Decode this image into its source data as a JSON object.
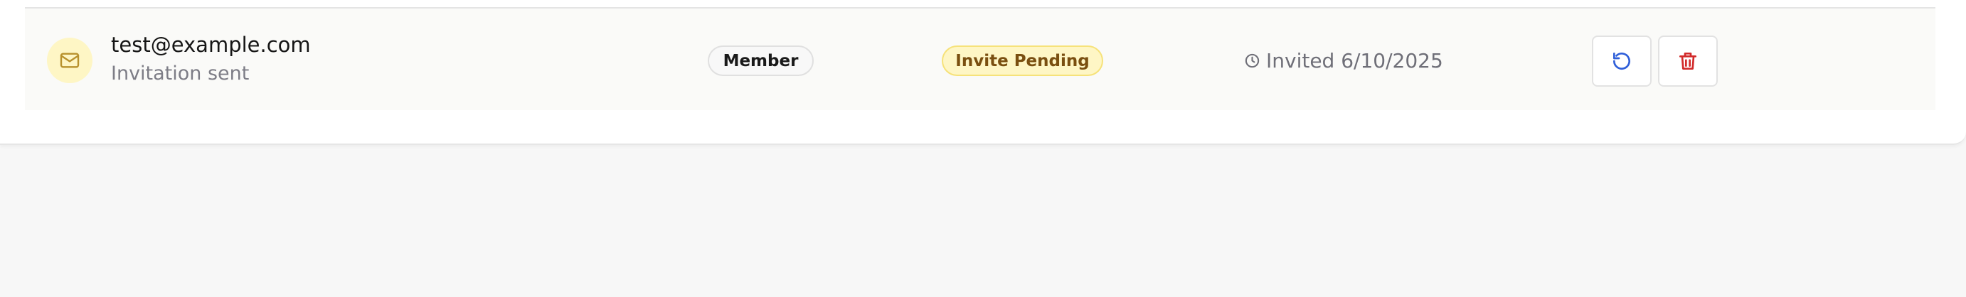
{
  "member_row": {
    "email": "test@example.com",
    "subtitle": "Invitation sent",
    "role": "Member",
    "status": "Invite Pending",
    "invited_text": "Invited 6/10/2025",
    "icons": {
      "avatar": "mail-icon",
      "invited": "clock-icon",
      "resend": "refresh-icon",
      "delete": "trash-icon"
    }
  },
  "colors": {
    "avatar_bg": "#fef6c5",
    "avatar_icon": "#b8912d",
    "status_bg": "#fef6c5",
    "status_border": "#f6e27a",
    "status_text": "#7a4f10",
    "resend_icon": "#2f5fd9",
    "delete_icon": "#d22a2a"
  }
}
